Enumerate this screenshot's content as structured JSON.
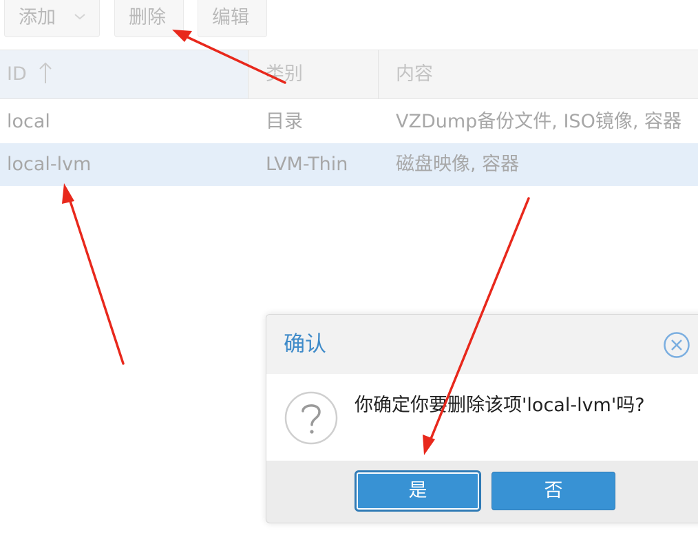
{
  "toolbar": {
    "add_label": "添加",
    "delete_label": "删除",
    "edit_label": "编辑"
  },
  "grid": {
    "columns": [
      "ID",
      "类别",
      "内容"
    ],
    "rows": [
      {
        "id": "local",
        "type": "目录",
        "content": "VZDump备份文件, ISO镜像, 容器"
      },
      {
        "id": "local-lvm",
        "type": "LVM-Thin",
        "content": "磁盘映像, 容器"
      }
    ]
  },
  "dialog": {
    "title": "确认",
    "message": "你确定你要删除该项'local-lvm'吗?",
    "yes_label": "是",
    "no_label": "否"
  },
  "colors": {
    "accent": "#3892d4",
    "title": "#3f8bc9",
    "selected_row": "#e4eef9",
    "annotation_arrow": "#e8281c"
  },
  "icons": [
    "chevron-down-icon",
    "sort-ascending-icon",
    "close-circle-icon",
    "question-icon",
    "annotation-arrow"
  ]
}
